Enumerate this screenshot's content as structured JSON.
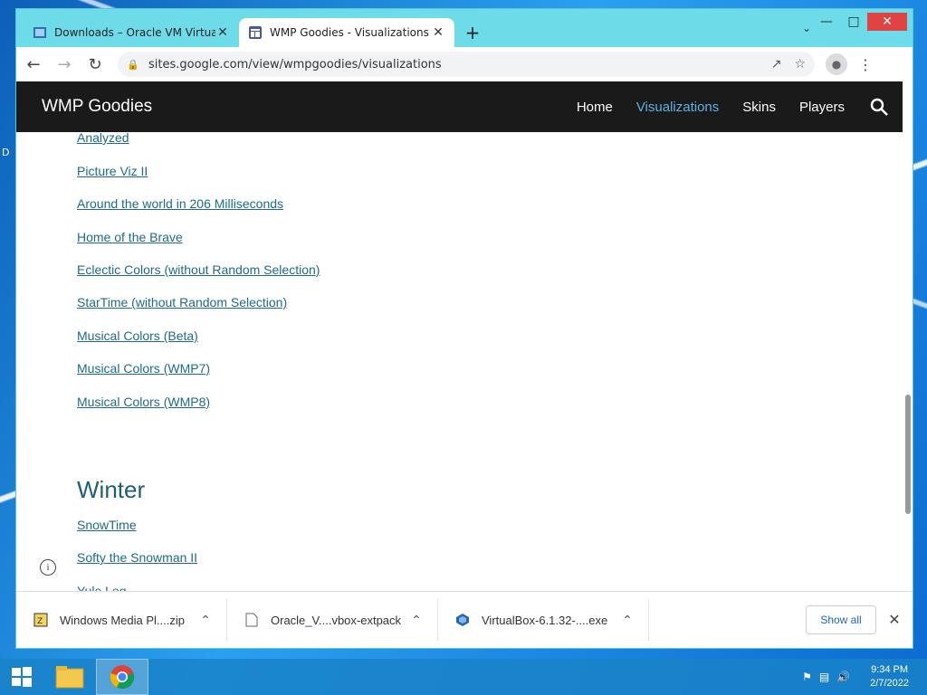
{
  "desktop": {
    "edge_letter": "D"
  },
  "browser": {
    "tabs": [
      {
        "title": "Downloads – Oracle VM VirtualB",
        "active": false
      },
      {
        "title": "WMP Goodies - Visualizations",
        "active": true
      }
    ],
    "url": "sites.google.com/view/wmpgoodies/visualizations"
  },
  "site": {
    "title": "WMP Goodies",
    "nav": [
      {
        "label": "Home",
        "active": false
      },
      {
        "label": "Visualizations",
        "active": true
      },
      {
        "label": "Skins",
        "active": false
      },
      {
        "label": "Players",
        "active": false
      }
    ]
  },
  "content": {
    "links_top": [
      "Analyzed",
      "Picture Viz II",
      "Around the world in 206 Milliseconds",
      "Home of the Brave",
      "Eclectic Colors (without Random Selection)",
      "StarTime (without Random Selection)",
      "Musical Colors (Beta)",
      "Musical Colors (WMP7)",
      "Musical Colors (WMP8)"
    ],
    "section_heading": "Winter",
    "links_winter": [
      "SnowTime",
      "Softy the Snowman II",
      "Yule Log"
    ]
  },
  "downloads": {
    "items": [
      {
        "name": "Windows Media Pl....zip",
        "icon": "zip-icon"
      },
      {
        "name": "Oracle_V....vbox-extpack",
        "icon": "file-icon"
      },
      {
        "name": "VirtualBox-6.1.32-....exe",
        "icon": "virtualbox-icon"
      }
    ],
    "show_all": "Show all"
  },
  "taskbar": {
    "time": "9:34 PM",
    "date": "2/7/2022"
  },
  "colors": {
    "link": "#1e6b8a",
    "nav_active": "#5ab4e6",
    "header_bg": "#1a1a1a",
    "window_frame": "#6edbe8"
  }
}
